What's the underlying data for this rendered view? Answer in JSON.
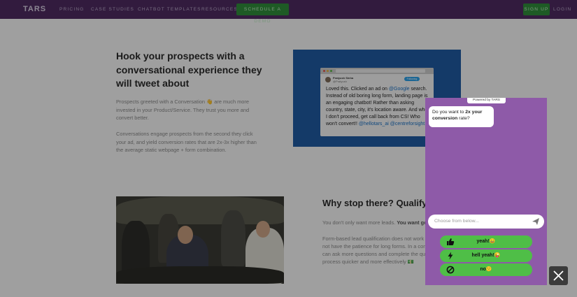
{
  "nav": {
    "logo": "TARS",
    "links": [
      "PRICING",
      "CASE STUDIES",
      "CHATBOT TEMPLATES",
      "RESOURCES"
    ],
    "demo_button": "SCHEDULE A DEMO",
    "signup_button": "SIGN UP",
    "login_link": "LOGIN"
  },
  "hero": {
    "title": "Hook your prospects with a conversational experience they will tweet about",
    "para1": "Prospects greeted with a Conversation 👋 are much more invested in your Product/Service. They trust you more and convert better.",
    "para2": "Conversations engage prospects from the second they click your ad, and yield conversion rates that are 2x-3x higher than the average static webpage + form combination."
  },
  "tweet": {
    "name": "Pratyush Sinha",
    "handle": "@Pratyush",
    "follow": "Following",
    "text_a": "Loved this. Clicked an ad on ",
    "link_google": "@Google",
    "text_b": " search. Instead of old boring long form, landing page is an engaging chatbot! Rather than asking country, state, city, it's location aware. And when I don't proceed, get call back from CS! Who won't convert!! ",
    "link_handles": "@hellotars_ai @centreforsight1"
  },
  "section2": {
    "title": "Why stop there? Qualify yo",
    "line1_a": "You don't only want more leads. ",
    "line1_b": "You want goo",
    "para_lines": [
      "Form-based lead qualification does not work a",
      "not have the patience for long forms. In a con",
      "can ask more questions and complete the qua",
      "process quicker and more effectively 💵"
    ]
  },
  "widget": {
    "powered_by": "Powered by TARS",
    "question_a": "Do you want to ",
    "question_b": "2x your conversion",
    "question_c": " rate?",
    "input_placeholder": "Choose from below...",
    "options": [
      {
        "label": "yeah!😀",
        "icon": "thumbs-up-icon"
      },
      {
        "label": "hell yeah!😜",
        "icon": "lightning-icon"
      },
      {
        "label": "no🙁",
        "icon": "no-icon"
      }
    ]
  },
  "colors": {
    "nav": "#4d2a60",
    "widget": "#8e5aa8",
    "option_green": "#4fbe47",
    "demo_green": "#2f8a3a"
  }
}
